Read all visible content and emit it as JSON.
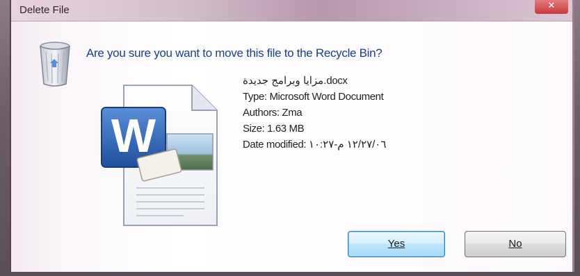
{
  "window": {
    "title": "Delete File",
    "close_glyph": "✕"
  },
  "dialog": {
    "question": "Are you sure you want to move this file to the Recycle Bin?",
    "file": {
      "name": "مزايا وبرامج جديدة.docx",
      "type": "Type: Microsoft Word Document",
      "authors": "Authors: Zma",
      "size": "Size: 1.63 MB",
      "date_modified": "Date modified: ١٢/٢٧/٠٦ م-١٠:٢٧"
    },
    "icons": {
      "left": "recycle-bin-icon",
      "file": "word-document-icon"
    }
  },
  "buttons": {
    "yes": "Yes",
    "no": "No"
  },
  "colors": {
    "question_text": "#1a3d8c",
    "yes_button": "#bee6fd",
    "word_blue": "#2b5797"
  }
}
